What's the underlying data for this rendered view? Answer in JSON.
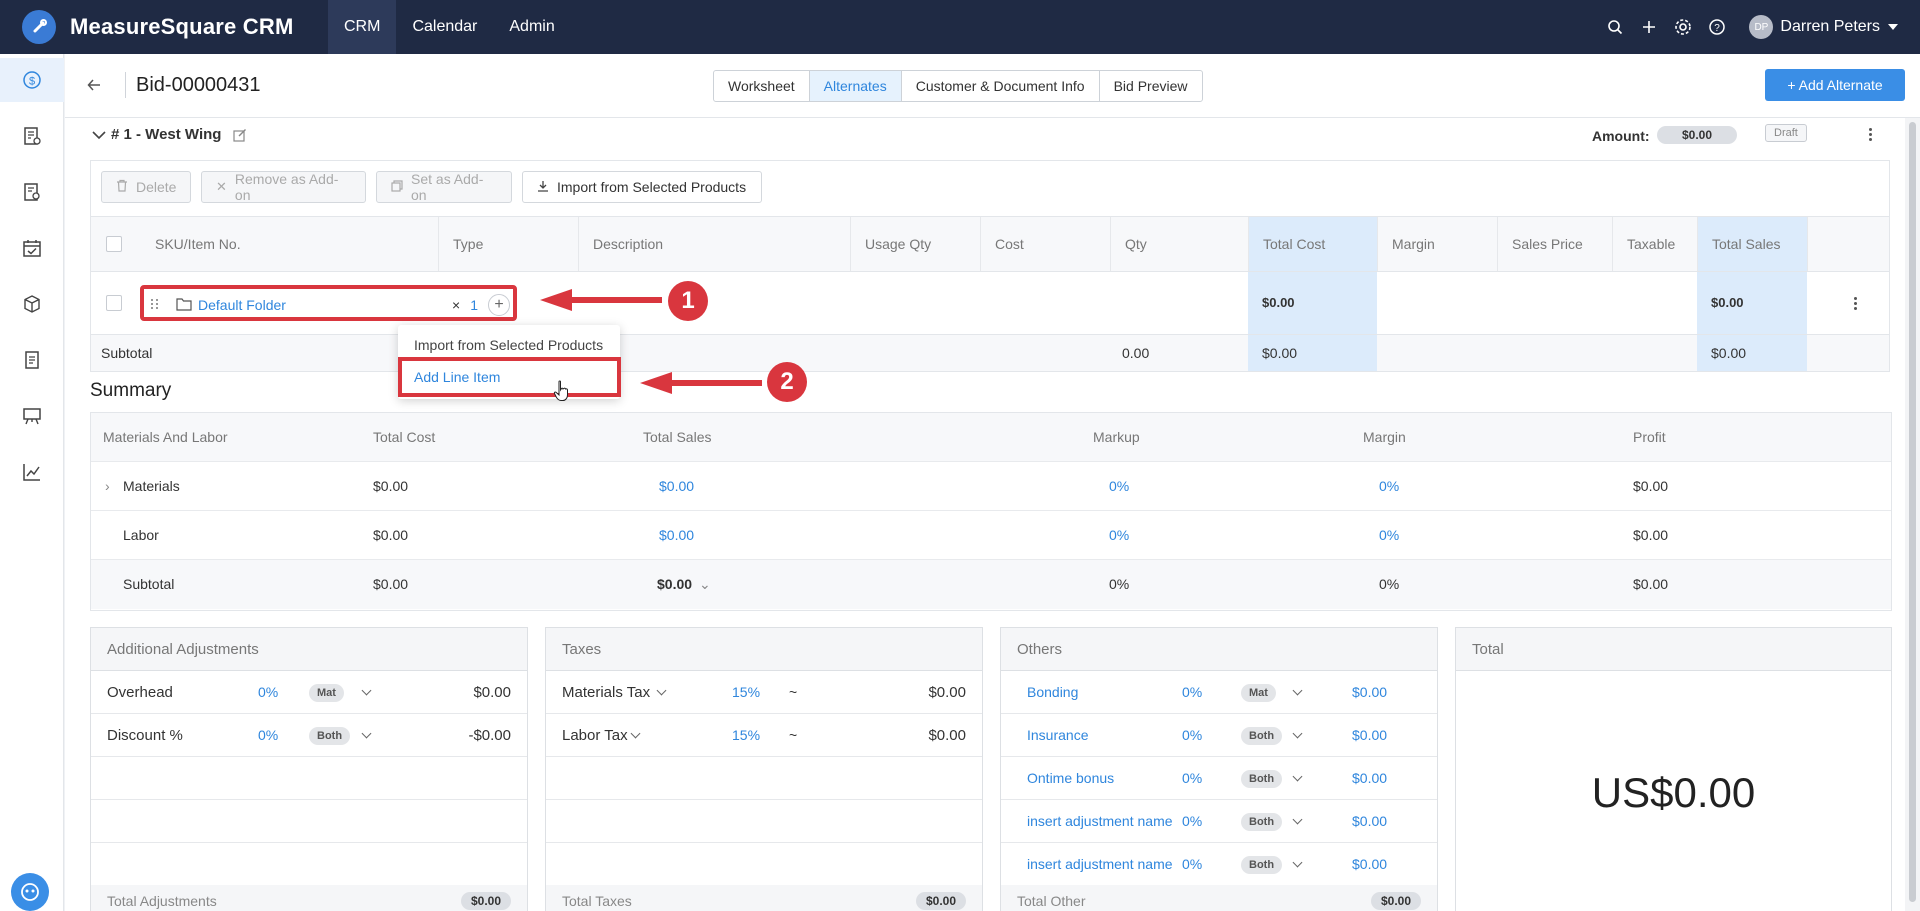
{
  "app": {
    "name": "MeasureSquare CRM",
    "nav": [
      "CRM",
      "Calendar",
      "Admin"
    ],
    "active_nav": "CRM",
    "user": {
      "initials": "DP",
      "name": "Darren Peters"
    }
  },
  "header": {
    "bid_title": "Bid-00000431",
    "tabs": [
      "Worksheet",
      "Alternates",
      "Customer & Document Info",
      "Bid Preview"
    ],
    "active_tab": "Alternates",
    "add_alternate_label": "+ Add Alternate"
  },
  "alternate": {
    "title": "# 1 - West Wing",
    "amount_label": "Amount:",
    "amount_value": "$0.00",
    "status": "Draft"
  },
  "toolbar": {
    "delete": "Delete",
    "remove_addon": "Remove as Add-on",
    "set_addon": "Set as Add-on",
    "import": "Import from Selected Products"
  },
  "grid": {
    "columns": [
      "SKU/Item No.",
      "Type",
      "Description",
      "Usage Qty",
      "Cost",
      "Qty",
      "Total Cost",
      "Margin",
      "Sales Price",
      "Taxable",
      "Total Sales"
    ],
    "folder_row": {
      "name": "Default Folder",
      "remove_glyph": "×",
      "count": "1",
      "total_cost": "$0.00",
      "total_sales": "$0.00"
    },
    "subtotal": {
      "label": "Subtotal",
      "qty": "0.00",
      "total_cost": "$0.00",
      "total_sales": "$0.00"
    }
  },
  "dropdown": {
    "items": [
      "Import from Selected Products",
      "Add Line Item"
    ]
  },
  "callouts": [
    "1",
    "2"
  ],
  "summary": {
    "title": "Summary",
    "headers": [
      "Materials And Labor",
      "Total Cost",
      "Total Sales",
      "Markup",
      "Margin",
      "Profit"
    ],
    "rows": [
      {
        "label": "Materials",
        "total_cost": "$0.00",
        "total_sales": "$0.00",
        "markup": "0%",
        "margin": "0%",
        "profit": "$0.00"
      },
      {
        "label": "Labor",
        "total_cost": "$0.00",
        "total_sales": "$0.00",
        "markup": "0%",
        "margin": "0%",
        "profit": "$0.00"
      },
      {
        "label": "Subtotal",
        "total_cost": "$0.00",
        "total_sales": "$0.00",
        "markup": "0%",
        "margin": "0%",
        "profit": "$0.00"
      }
    ]
  },
  "adjustments": {
    "title": "Additional Adjustments",
    "rows": [
      {
        "label": "Overhead",
        "pct": "0%",
        "basis": "Mat",
        "value": "$0.00"
      },
      {
        "label": "Discount %",
        "pct": "0%",
        "basis": "Both",
        "value": "-$0.00"
      }
    ],
    "footer_label": "Total Adjustments",
    "footer_value": "$0.00"
  },
  "taxes": {
    "title": "Taxes",
    "rows": [
      {
        "label": "Materials Tax",
        "pct": "15%",
        "approx": "~",
        "value": "$0.00"
      },
      {
        "label": "Labor Tax",
        "pct": "15%",
        "approx": "~",
        "value": "$0.00"
      }
    ],
    "footer_label": "Total Taxes",
    "footer_value": "$0.00"
  },
  "others": {
    "title": "Others",
    "rows": [
      {
        "label": "Bonding",
        "pct": "0%",
        "basis": "Mat",
        "value": "$0.00"
      },
      {
        "label": "Insurance",
        "pct": "0%",
        "basis": "Both",
        "value": "$0.00"
      },
      {
        "label": "Ontime bonus",
        "pct": "0%",
        "basis": "Both",
        "value": "$0.00"
      },
      {
        "label": "insert adjustment name",
        "pct": "0%",
        "basis": "Both",
        "value": "$0.00"
      },
      {
        "label": "insert adjustment name",
        "pct": "0%",
        "basis": "Both",
        "value": "$0.00"
      }
    ],
    "footer_label": "Total Other",
    "footer_value": "$0.00"
  },
  "total": {
    "title": "Total",
    "value": "US$0.00"
  },
  "colors": {
    "topbar": "#1f2a44",
    "accent": "#3a8ee6",
    "link": "#2f86dd",
    "annotation_red": "#d9363e",
    "highlight_column": "#dcebfb"
  }
}
